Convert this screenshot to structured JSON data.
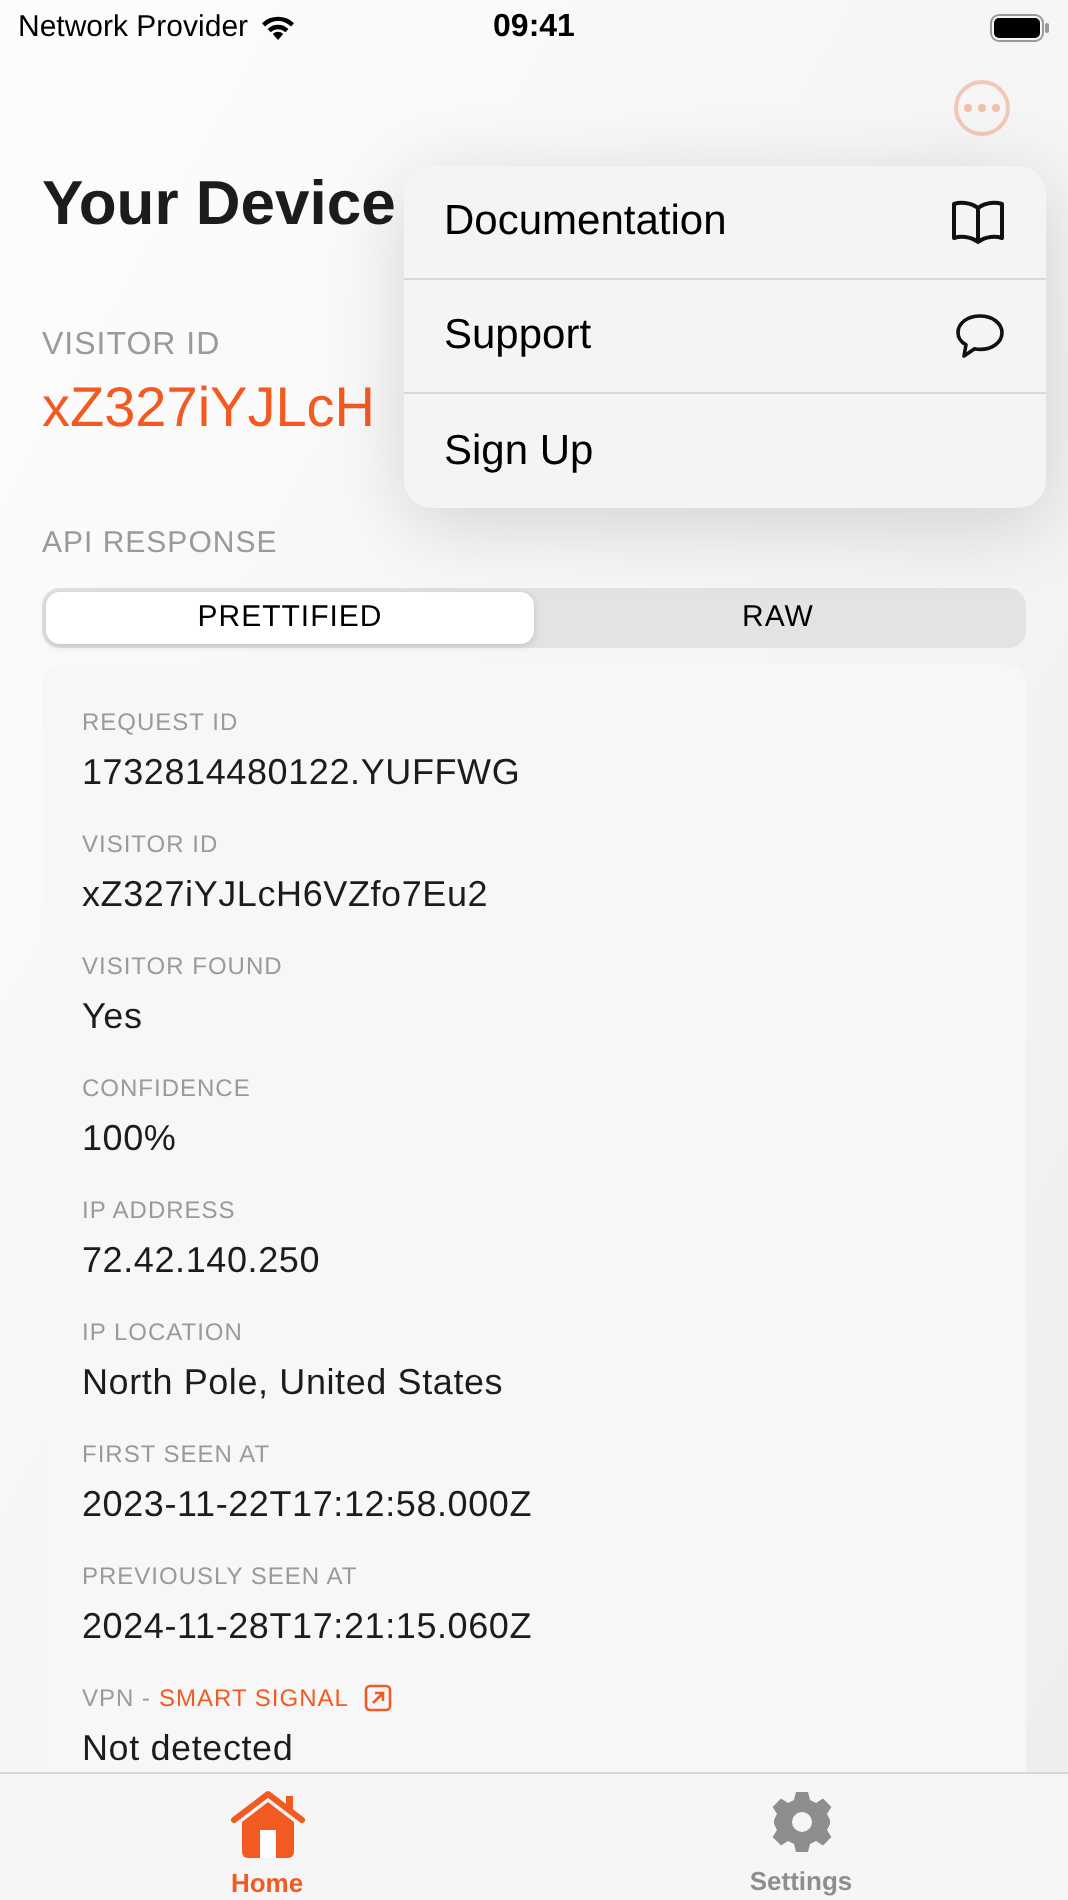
{
  "status_bar": {
    "carrier": "Network Provider",
    "time": "09:41"
  },
  "header": {
    "title": "Your Device"
  },
  "menu": {
    "items": [
      {
        "label": "Documentation"
      },
      {
        "label": "Support"
      },
      {
        "label": "Sign Up"
      }
    ]
  },
  "visitor": {
    "label": "VISITOR ID",
    "value": "xZ327iYJLcH"
  },
  "api_response": {
    "label": "API RESPONSE",
    "segments": [
      {
        "label": "PRETTIFIED",
        "selected": true
      },
      {
        "label": "RAW",
        "selected": false
      }
    ]
  },
  "fields": [
    {
      "kind": "plain",
      "label": "REQUEST ID",
      "value": "1732814480122.YUFFWG"
    },
    {
      "kind": "plain",
      "label": "VISITOR ID",
      "value": "xZ327iYJLcH6VZfo7Eu2"
    },
    {
      "kind": "plain",
      "label": "VISITOR FOUND",
      "value": "Yes"
    },
    {
      "kind": "plain",
      "label": "CONFIDENCE",
      "value": "100%"
    },
    {
      "kind": "plain",
      "label": "IP ADDRESS",
      "value": "72.42.140.250"
    },
    {
      "kind": "plain",
      "label": "IP LOCATION",
      "value": "North Pole, United States"
    },
    {
      "kind": "plain",
      "label": "FIRST SEEN AT",
      "value": "2023-11-22T17:12:58.000Z"
    },
    {
      "kind": "plain",
      "label": "PREVIOUSLY SEEN AT",
      "value": "2024-11-28T17:21:15.060Z"
    },
    {
      "kind": "link",
      "label": "VPN -",
      "link": "SMART SIGNAL",
      "value": "Not detected"
    }
  ],
  "tab_bar": {
    "tabs": [
      {
        "label": "Home",
        "selected": true
      },
      {
        "label": "Settings",
        "selected": false
      }
    ]
  }
}
